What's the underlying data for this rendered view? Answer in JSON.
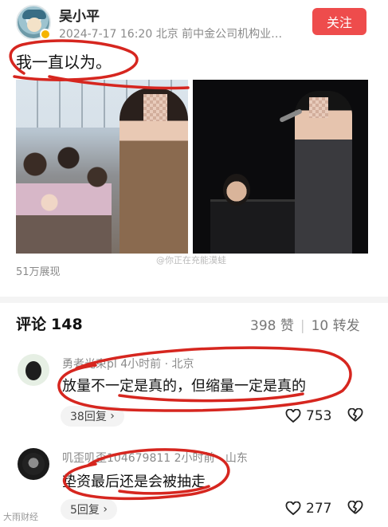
{
  "post": {
    "author": "吴小平",
    "meta": "2024-7-17 16:20  北京  前中金公司机构业…",
    "follow_label": "关注",
    "text": "我一直以为。",
    "views": "51万展现",
    "image_watermark": "@你正在充能漠蛙"
  },
  "comments_header": {
    "title": "评论",
    "count": "148",
    "likes": "398 赞",
    "shares": "10 转发"
  },
  "comments": [
    {
      "name_meta": "勇者光束pl  4小时前 · 北京",
      "text": "放量不一定是真的，但缩量一定是真的",
      "reply_label": "38回复",
      "likes": "753"
    },
    {
      "name_meta": "叽歪叽歪104679811  2小时前 · 山东",
      "text": "垫资最后还是会被抽走",
      "reply_label": "5回复",
      "likes": "277"
    }
  ],
  "corner_mark": "大雨财经",
  "colors": {
    "accent": "#ee4c4c",
    "scribble": "#d6261f"
  }
}
